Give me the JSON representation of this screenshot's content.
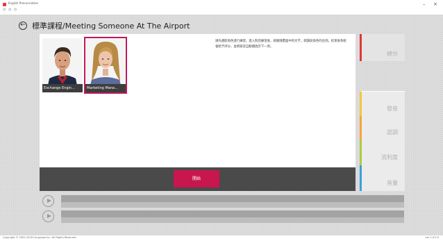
{
  "window": {
    "title": "English Pronunciation",
    "minimize_glyph": "–",
    "close_glyph": "×",
    "toolbar_glyphs": "◷ ◷ ◷"
  },
  "header": {
    "back_glyph": "←",
    "title": "標準課程/Meeting Someone At The Airport"
  },
  "roles": [
    {
      "label": "Exchange Engin...",
      "selected": false
    },
    {
      "label": "Marketing Mana...",
      "selected": true
    }
  ],
  "description": "請先選取角色進行練習。進入對話練習後，請跟隨畫面中的文字，朗讀該角色的台詞。結束後系統會給予評分，並將錄音自動播放於下一頁。",
  "actions": {
    "start_label": "開始"
  },
  "scores": {
    "total_label": "總分",
    "pronunciation_label": "發音",
    "intonation_label": "語調",
    "fluency_label": "流利度",
    "vocabulary_label": "音量"
  },
  "footer": {
    "copyright": "Copyright © 2002-2018 Language Inc. All Rights Reserved.",
    "version": "ver 1.0.0.0"
  },
  "colors": {
    "accent": "#c8174f",
    "total": "#e2363a",
    "pronunciation": "#f2c93d",
    "intonation": "#f7a43a",
    "fluency": "#a7cf42",
    "vocabulary": "#3aa0e0"
  }
}
